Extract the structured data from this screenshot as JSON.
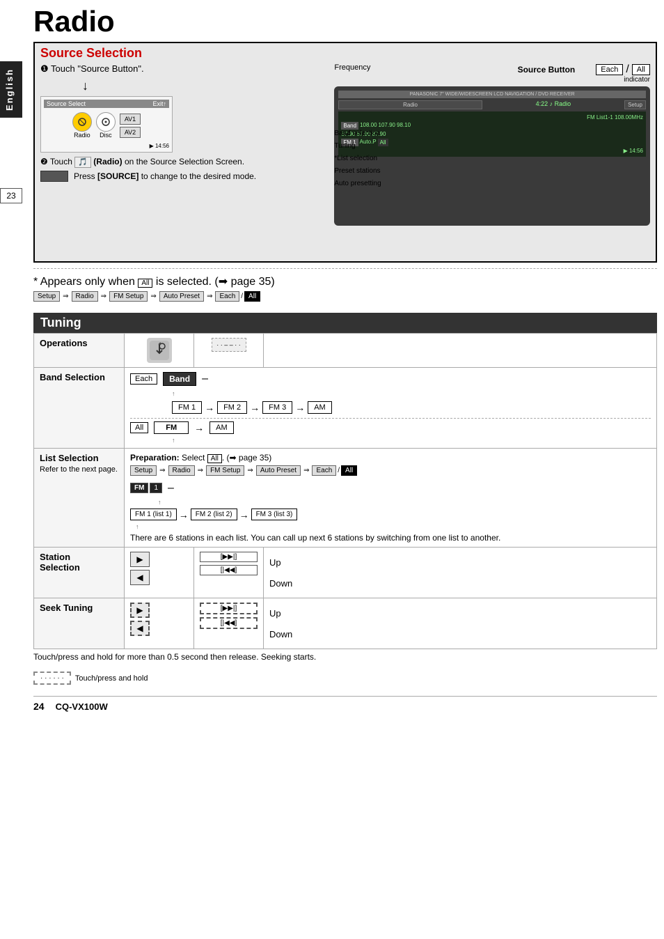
{
  "page": {
    "title": "Radio",
    "side_tab": "English",
    "page_number_left": "23",
    "page_number_bottom": "24",
    "model": "CQ-VX100W"
  },
  "source_section": {
    "title": "Source Selection",
    "step1": "❶ Touch \"Source Button\".",
    "step2_prefix": "❷ Touch",
    "step2_icon": "🎵",
    "step2_text": "(Radio) on the Source Selection Screen.",
    "press_source": "Press [SOURCE] to change to the desired mode.",
    "screen_title": "Source Select",
    "screen_exit": "Exit↑",
    "screen_icons": [
      "Radio",
      "Disc"
    ],
    "screen_av": [
      "AV1",
      "AV2"
    ],
    "screen_time": "▶ 14:56",
    "frequency_label": "Frequency",
    "source_button_label": "Source Button",
    "each_label": "Each",
    "slash": "/",
    "all_label": "All",
    "indicator_label": "indicator",
    "band_selection_label": "Band selection",
    "tuning_label": "Tuning",
    "list_selection_label": "*List selection",
    "preset_stations_label": "Preset stations",
    "auto_presetting_label": "Auto presetting",
    "source_below": "[SOURCE]",
    "ioi_label": "[|◀◀] [▶▶|]"
  },
  "asterisk_note": {
    "text1": "* Appears only when",
    "all_box": "All",
    "text2": "is selected. (➡ page 35)"
  },
  "breadcrumb": {
    "items": [
      "Setup",
      "Radio",
      "FM Setup",
      "Auto Preset",
      "Each",
      "/",
      "All"
    ]
  },
  "tuning": {
    "title": "Tuning",
    "rows": [
      {
        "label": "Operations",
        "ops_icon1": "👆",
        "ops_text": "– – – –"
      },
      {
        "label": "Band Selection",
        "each_label": "Each",
        "band_btn": "Band",
        "dash": "–",
        "flow_each": [
          "FM 1",
          "FM 2",
          "FM 3",
          "AM"
        ],
        "all_label": "All",
        "flow_all_start": "FM",
        "flow_all_end": "AM"
      },
      {
        "label": "List Selection",
        "sublabel": "Refer to the next page.",
        "prep_text": "Preparation: Select",
        "all_box": "All",
        "prep_suffix": ". (➡ page 35)",
        "breadcrumb": [
          "Setup",
          "Radio",
          "FM Setup",
          "Auto Preset",
          "Each",
          "/",
          "All"
        ],
        "fm_label": "FM",
        "num_label": "1",
        "dash": "–",
        "list_flow": [
          "FM 1 (list 1)",
          "FM 2 (list 2)",
          "FM 3 (list 3)"
        ],
        "description": "There are 6 stations in each list. You can call up next 6 stations by switching from one list to another."
      },
      {
        "label": "Station\nSelection",
        "forward_btn": "▶",
        "forward_nav": "[▶▶|]",
        "up_label": "Up",
        "back_btn": "◀",
        "back_nav": "[|◀◀]",
        "down_label": "Down"
      },
      {
        "label": "Seek Tuning",
        "forward_btn": "▶",
        "forward_nav": "[▶▶|]",
        "up_label": "Up",
        "back_btn": "◀",
        "back_nav": "[|◀◀]",
        "down_label": "Down",
        "note": "Touch/press and hold for more than 0.5 second then release. Seeking starts."
      }
    ]
  },
  "footer": {
    "dashed_box": "· · · · · ·",
    "text": "Touch/press and hold"
  }
}
